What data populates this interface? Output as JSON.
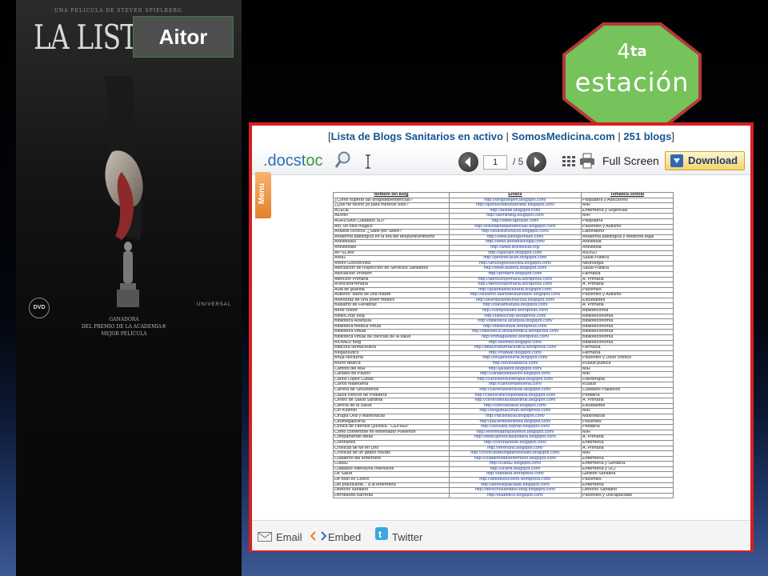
{
  "poster": {
    "credit": "UNA PELICULA DE STEVEN SPIELBERG",
    "title": "LA LISTA DE",
    "dvd_logo": "DVD",
    "studio_logo": "UNIVERSAL",
    "award_line_1": "GANADORA",
    "award_line_2": "DEL PREMIO DE LA ACADEMIA®",
    "award_line_3": "MEJOR PELÍCULA"
  },
  "name_label": "Aitor",
  "station": {
    "number": "4",
    "suffix": "ta",
    "word": "estación"
  },
  "embed": {
    "title_open": "[",
    "title_link": "Lista de Blogs Sanitarios en activo",
    "sep1": " | ",
    "site_link": "SomosMedicina.com",
    "sep2": " | ",
    "count_link": "251 blogs",
    "title_close": "]",
    "logo": ".docst",
    "logo_accent": "oc",
    "page_current": "1",
    "page_total": "/ 5",
    "fullscreen": "Full Screen",
    "download": "Download",
    "menu": "Menu",
    "share": {
      "email": "Email",
      "embed": "Embed",
      "twitter": "Twitter"
    }
  },
  "document": {
    "headers": [
      "Nombre del Blog",
      "Enlace",
      "Temática central"
    ],
    "rows": [
      [
        "¿Cómo superar las drogodependencias?",
        "http://drogodepen.blogspot.com/",
        "Psiquiatría y Adicciones"
      ],
      [
        "¿Qué he hecho yo para merecer esto?",
        "http://quehecedeseperllide.blogspot.com/",
        "MIR"
      ],
      [
        "ACEDE",
        "http://acede.blogspot.com/",
        "Enfermería y Urgencias"
      ],
      [
        "AEMIR",
        "http://aemirblog.blogspot.com/",
        "MIR"
      ],
      [
        "AGRUSAN Cuidados SLP",
        "http://www.agrusan.com/",
        "Psiquiatría"
      ],
      [
        "Ahí, un niño mágico",
        "http://elevitaindependencias.blogspot.com/",
        "Pacientes y Autismo"
      ],
      [
        "Análisis clínicos: ¿Sabe por usted?",
        "http://analisisclinicos.blogspot.com/",
        "Laboratorio"
      ],
      [
        "Anatomía patológica en la era del despunticentrismo",
        "http://www.jokingsonaes.com/",
        "Anatomía patológica y Medicina legal"
      ],
      [
        "AnestesiaS",
        "http://www.anestesiologia.com/",
        "Anestesia"
      ],
      [
        "AnestesiaR",
        "http://www.anestesiar.org/",
        "Anestesia"
      ],
      [
        "AP-SCAM",
        "http://apscam.blogspot.com/",
        "AS/ISO"
      ],
      [
        "Area1",
        "http://persnecacdo.blogspot.com/",
        "Salud Pública"
      ],
      [
        "Arturo Goicoechea",
        "http://arturogoicoechea.blogspot.com/",
        "Neurología"
      ],
      [
        "Asociación de Inspección de Servicios Sanitarios",
        "http://www.asisnra.blogspot.com/",
        "Salud Pública"
      ],
      [
        "Asociación Profarm",
        "http://profarm.blogspot.com/",
        "Farmacia"
      ],
      [
        "Atención Primaria",
        "http://atencionprimaria.wordpress.com/",
        "A. Primaria"
      ],
      [
        "ATenciónPrimaria",
        "http://atencionprimaria.wordpress.com/",
        "A. Primaria"
      ],
      [
        "Aula de guardia",
        "http://guardiasfacturaria.blogspot.com/",
        "Pacientes"
      ],
      [
        "Autismo: diario de una madre",
        "http://autismo-diariodeunamadre.blogspot.com/",
        "Pacientes y Autismo"
      ],
      [
        "Aventuras de una joven médico",
        "http://aventurasdeunacosa.blogspot.com/",
        "Estudiantes"
      ],
      [
        "Bálsamo de Fierabrás",
        "http://balsamiaruba.blogspot.com/",
        "A. Primaria"
      ],
      [
        "Bene colore",
        "http://camposudrit.wordpress.com/",
        "Bibliotecomía"
      ],
      [
        "BiblioChop blog",
        "http://bibliochop.wordpress.com/",
        "Biblioteconomía"
      ],
      [
        "Biblioteca Azarquía",
        "http://biblioteca.azarquia.blogspot.com/",
        "Biblioteconomía"
      ],
      [
        "Biblioteca médica virtual",
        "http://bibliovirtual.wordpress.com/",
        "Biblioteconomía"
      ],
      [
        "Biblioteca virtual",
        "http://biblioteca.virtualmedica.wordpress.com/",
        "Biblioteconomía"
      ],
      [
        "Biblioteca virtual de ciencias de la salud",
        "http://mmaguedino.wordpress.com/",
        "Biblioteconomía"
      ],
      [
        "BIOMED blog",
        "http://biomed.blogspot.com/",
        "Biblioteconomía"
      ],
      [
        "Bitácora farmacéutica",
        "http://bitacorafarmaceutica.wordpress.com/",
        "Farmacia"
      ],
      [
        "Blogaceutics",
        "http://matwar.blogspot.com/",
        "Farmacia"
      ],
      [
        "Bruja Nocturna",
        "http://brujanocturna.blogspot.com/",
        "Pacientes y Dolor crónico"
      ],
      [
        "Bruno Abarca",
        "http://brunoabarca.com/",
        "eSalud pública"
      ],
      [
        "Camino del MIR",
        "http://jaisantir.blogspot.com/",
        "MIR"
      ],
      [
        "Canales de Pavlov",
        "http://canalesdepavlov.blogspot.com/",
        "MIR"
      ],
      [
        "Carlos López Cubas",
        "http://carlosbrifisioterapia.blogspot.com/",
        "Fisioterapia"
      ],
      [
        "Carlos Mateluena",
        "http://carlosmateluena.com/",
        "eSalud"
      ],
      [
        "Carrera de Secundinos",
        "http://carreraselectivas.blogspot.com/",
        "Cuidados Paliativos"
      ],
      [
        "Casos clínicos de Pediatría",
        "http://casosclinicospediatria.blogspot.com/",
        "Pediatría"
      ],
      [
        "Centro de Salud Sardinal",
        "http://centrodesaludsardinal.blogspot.com/",
        "A. Primaria"
      ],
      [
        "Ciencia de la Salud",
        "http://cienciasalud.blogspot.com/",
        "Estudiantes"
      ],
      [
        "Cirí Kozmin",
        "http://blogdelaczman.wordpress.com/",
        "MIR"
      ],
      [
        "Cirugía Oral y Maxilofacial",
        "http://facilofacial.blogspot.com/",
        "Maxilofacial"
      ],
      [
        "Citomegalovirus",
        "http://pacientesenlinea.blogspot.com/",
        "Pacientes"
      ],
      [
        "Clínica de Fibrosis Quística - CEPREP",
        "http://clinicafq-ceprep.blogspot.com/",
        "Pediatría"
      ],
      [
        "Cómo convertirse en entrenador Pokemon",
        "http://entrenadorpokemon.blogspot.com/",
        "MIR"
      ],
      [
        "Compartiendo ideas",
        "http://www.gerenciasanitaria.blogspot.com/",
        "A. Primaria"
      ],
      [
        "Coronarios",
        "http://coronariosfe.blogspot.com/",
        "Enfermería"
      ],
      [
        "Crónicas de Mr en Uno",
        "http://mrenuno.blogspot.com/",
        "A. Primaria"
      ],
      [
        "Crónicas de un gitano novato",
        "http://cronicasdeungitanonovato.blogspot.com/",
        "MIR"
      ],
      [
        "Cuaderno del enfermero",
        "http://cuadernodelenfermero.blogspot.com/",
        "Enfermería"
      ],
      [
        "Cuida2",
        "http://cuida2.blogspot.com/",
        "Enfermería y Geriatría"
      ],
      [
        "Cuidados Intensivos Intensivos",
        "http://ucient.blogspot.com/",
        "Enfermería y UCI"
      ],
      [
        "De Salud",
        "http://dasalud.wordpress.com/",
        "Gestión Sanitaria"
      ],
      [
        "De todo es Colors",
        "http://detodoescolors.wordpress.com/",
        "Pacientes"
      ],
      [
        "Del practicante... a la enfermera",
        "http://antoniopalcalde.blogspot.com/",
        "Enfermería"
      ],
      [
        "Derecho sanitario",
        "http://derechosanitario-blog.blogspot.com/",
        "Derecho Sanitario"
      ],
      [
        "Derribando barreras",
        "http://diabetico.blogspot.com/",
        "Pacientes y Discapacidad"
      ]
    ]
  }
}
